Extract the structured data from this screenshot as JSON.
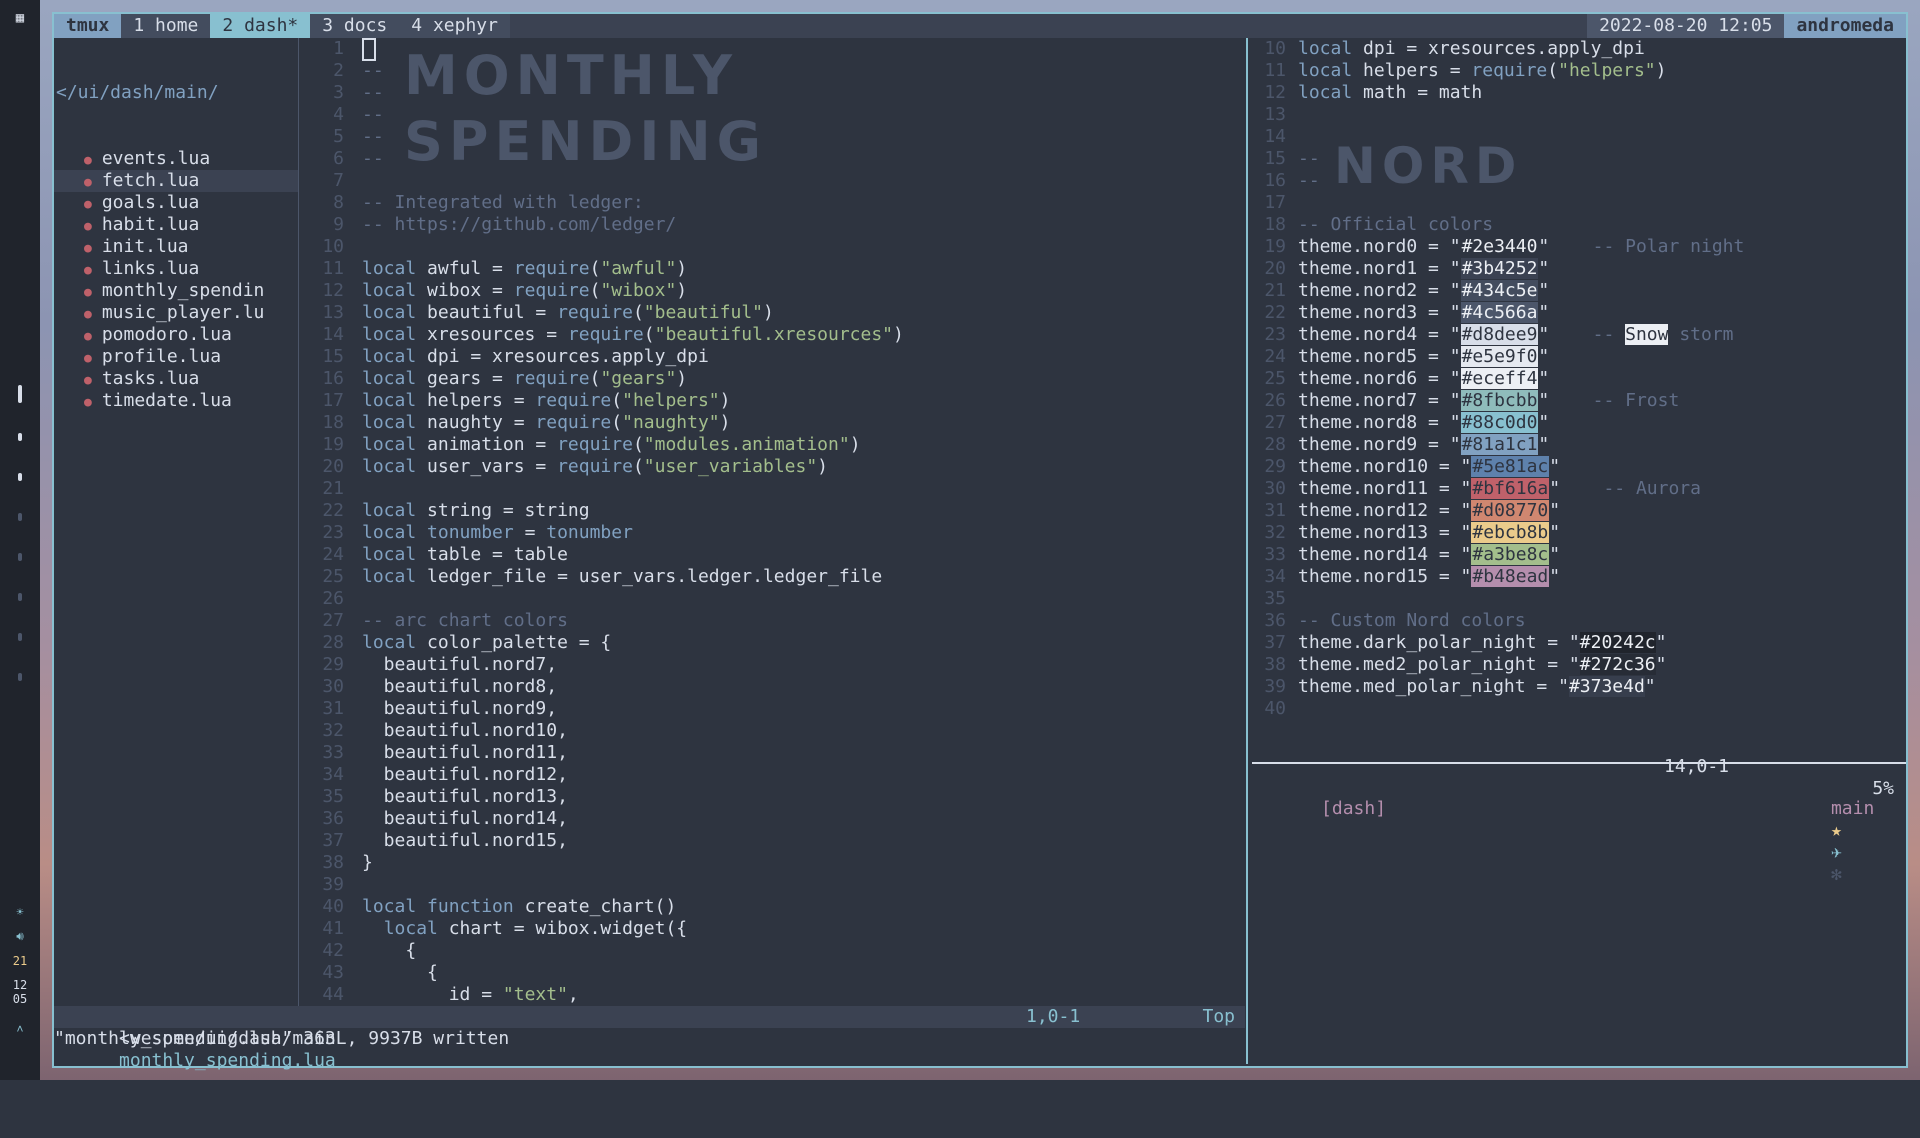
{
  "sidebar": {
    "top_icon": "grid-icon",
    "bottom": {
      "brightness_icon": "sun-icon",
      "volume_icon": "speaker-icon",
      "clock_hour": "12",
      "clock_min": "05",
      "cpu": "21",
      "arch_icon": "arch-icon"
    }
  },
  "tmux": {
    "name": "tmux",
    "windows": [
      "1 home",
      "2 dash*",
      "3 docs",
      "4 xephyr"
    ],
    "date": "2022-08-20 12:05",
    "host": "andromeda"
  },
  "tree": {
    "path": "</ui/dash/main/",
    "files": [
      "events.lua",
      "fetch.lua",
      "goals.lua",
      "habit.lua",
      "init.lua",
      "links.lua",
      "monthly_spendin",
      "music_player.lu",
      "pomodoro.lua",
      "profile.lua",
      "tasks.lua",
      "timedate.lua"
    ]
  },
  "banner": {
    "line1": "MONTHLY",
    "line2": "SPENDING",
    "nord": "NORD"
  },
  "left_code": [
    [
      "1",
      ""
    ],
    [
      "2",
      "--"
    ],
    [
      "3",
      "--"
    ],
    [
      "4",
      "--"
    ],
    [
      "5",
      "--"
    ],
    [
      "6",
      "--"
    ],
    [
      "7",
      ""
    ],
    [
      "8",
      "-- Integrated with ledger:"
    ],
    [
      "9",
      "-- https://github.com/ledger/"
    ],
    [
      "10",
      ""
    ],
    [
      "11",
      "local awful = require(\"awful\")"
    ],
    [
      "12",
      "local wibox = require(\"wibox\")"
    ],
    [
      "13",
      "local beautiful = require(\"beautiful\")"
    ],
    [
      "14",
      "local xresources = require(\"beautiful.xresources\")"
    ],
    [
      "15",
      "local dpi = xresources.apply_dpi"
    ],
    [
      "16",
      "local gears = require(\"gears\")"
    ],
    [
      "17",
      "local helpers = require(\"helpers\")"
    ],
    [
      "18",
      "local naughty = require(\"naughty\")"
    ],
    [
      "19",
      "local animation = require(\"modules.animation\")"
    ],
    [
      "20",
      "local user_vars = require(\"user_variables\")"
    ],
    [
      "21",
      ""
    ],
    [
      "22",
      "local string = string"
    ],
    [
      "23",
      "local tonumber = tonumber"
    ],
    [
      "24",
      "local table = table"
    ],
    [
      "25",
      "local ledger_file = user_vars.ledger.ledger_file"
    ],
    [
      "26",
      ""
    ],
    [
      "27",
      "-- arc chart colors"
    ],
    [
      "28",
      "local color_palette = {"
    ],
    [
      "29",
      "  beautiful.nord7,"
    ],
    [
      "30",
      "  beautiful.nord8,"
    ],
    [
      "31",
      "  beautiful.nord9,"
    ],
    [
      "32",
      "  beautiful.nord10,"
    ],
    [
      "33",
      "  beautiful.nord11,"
    ],
    [
      "34",
      "  beautiful.nord12,"
    ],
    [
      "35",
      "  beautiful.nord13,"
    ],
    [
      "36",
      "  beautiful.nord14,"
    ],
    [
      "37",
      "  beautiful.nord15,"
    ],
    [
      "38",
      "}"
    ],
    [
      "39",
      ""
    ],
    [
      "40",
      "local function create_chart()"
    ],
    [
      "41",
      "  local chart = wibox.widget({"
    ],
    [
      "42",
      "    {"
    ],
    [
      "43",
      "      {"
    ],
    [
      "44",
      "        id = \"text\","
    ]
  ],
  "status_left": {
    "path": "<wesome/ui/dash/main",
    "file": "monthly_spending.lua",
    "pos": "1,0-1",
    "top": "Top"
  },
  "message": "\"monthly_spending.lua\" 363L, 9937B written",
  "right_code": [
    [
      "10",
      "local dpi = xresources.apply_dpi"
    ],
    [
      "11",
      "local helpers = require(\"helpers\")"
    ],
    [
      "12",
      "local math = math"
    ],
    [
      "13",
      ""
    ],
    [
      "14",
      ""
    ],
    [
      "15",
      "--"
    ],
    [
      "16",
      "--"
    ],
    [
      "17",
      ""
    ],
    [
      "18",
      "-- Official colors"
    ]
  ],
  "theme_lines": [
    {
      "n": "19",
      "k": "theme.nord0 = \"",
      "v": "#2e3440",
      "c": "-- Polar night"
    },
    {
      "n": "20",
      "k": "theme.nord1 = \"",
      "v": "#3b4252",
      "c": ""
    },
    {
      "n": "21",
      "k": "theme.nord2 = \"",
      "v": "#434c5e",
      "c": ""
    },
    {
      "n": "22",
      "k": "theme.nord3 = \"",
      "v": "#4c566a",
      "c": ""
    },
    {
      "n": "23",
      "k": "theme.nord4 = \"",
      "v": "#d8dee9",
      "c": "-- Snow storm"
    },
    {
      "n": "24",
      "k": "theme.nord5 = \"",
      "v": "#e5e9f0",
      "c": ""
    },
    {
      "n": "25",
      "k": "theme.nord6 = \"",
      "v": "#eceff4",
      "c": ""
    },
    {
      "n": "26",
      "k": "theme.nord7 = \"",
      "v": "#8fbcbb",
      "c": "-- Frost"
    },
    {
      "n": "27",
      "k": "theme.nord8 = \"",
      "v": "#88c0d0",
      "c": ""
    },
    {
      "n": "28",
      "k": "theme.nord9 = \"",
      "v": "#81a1c1",
      "c": ""
    },
    {
      "n": "29",
      "k": "theme.nord10 = \"",
      "v": "#5e81ac",
      "c": ""
    },
    {
      "n": "30",
      "k": "theme.nord11 = \"",
      "v": "#bf616a",
      "c": "-- Aurora"
    },
    {
      "n": "31",
      "k": "theme.nord12 = \"",
      "v": "#d08770",
      "c": ""
    },
    {
      "n": "32",
      "k": "theme.nord13 = \"",
      "v": "#ebcb8b",
      "c": ""
    },
    {
      "n": "33",
      "k": "theme.nord14 = \"",
      "v": "#a3be8c",
      "c": ""
    },
    {
      "n": "34",
      "k": "theme.nord15 = \"",
      "v": "#b48ead",
      "c": ""
    }
  ],
  "right_tail": [
    [
      "35",
      ""
    ],
    [
      "36",
      "-- Custom Nord colors"
    ]
  ],
  "custom_lines": [
    {
      "n": "37",
      "k": "theme.dark_polar_night = \"",
      "v": "#20242c"
    },
    {
      "n": "38",
      "k": "theme.med2_polar_night = \"",
      "v": "#272c36"
    },
    {
      "n": "39",
      "k": "theme.med_polar_night = \"",
      "v": "#373e4d"
    }
  ],
  "right_last": [
    "40",
    ""
  ],
  "status_right": {
    "pos": "14,0-1",
    "pct": "5%"
  },
  "prompt": {
    "session": "[dash]",
    "branch": "main",
    "icons": [
      "★",
      "✈",
      "✻"
    ]
  }
}
